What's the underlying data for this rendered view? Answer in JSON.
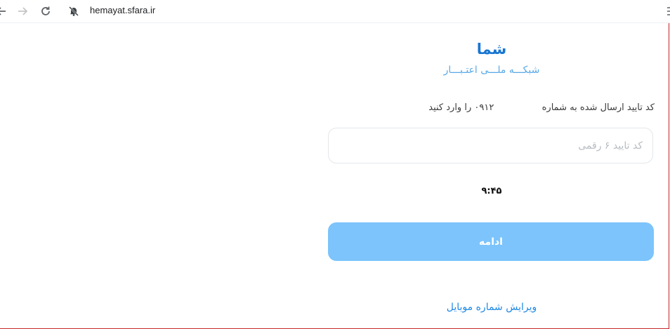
{
  "browser": {
    "url": "hemayat.sfara.ir"
  },
  "brand": {
    "title": "شما",
    "subtitle": "شبکـــه ملـــی اعتـبـــار"
  },
  "verification": {
    "instruction_prefix": "کد تایید ارسال شده به شماره",
    "phone_prefix": "۰۹۱۲",
    "instruction_suffix": "را وارد کنید",
    "input_placeholder": "کد تایید ۶ رقمی",
    "input_value": "",
    "timer": "۹:۴۵"
  },
  "actions": {
    "continue_label": "ادامه",
    "edit_mobile_label": "ویرایش شماره موبایل"
  },
  "colors": {
    "brand_blue": "#1976d2",
    "button_bg": "#7cc4fb",
    "link_blue": "#1e88e5"
  }
}
